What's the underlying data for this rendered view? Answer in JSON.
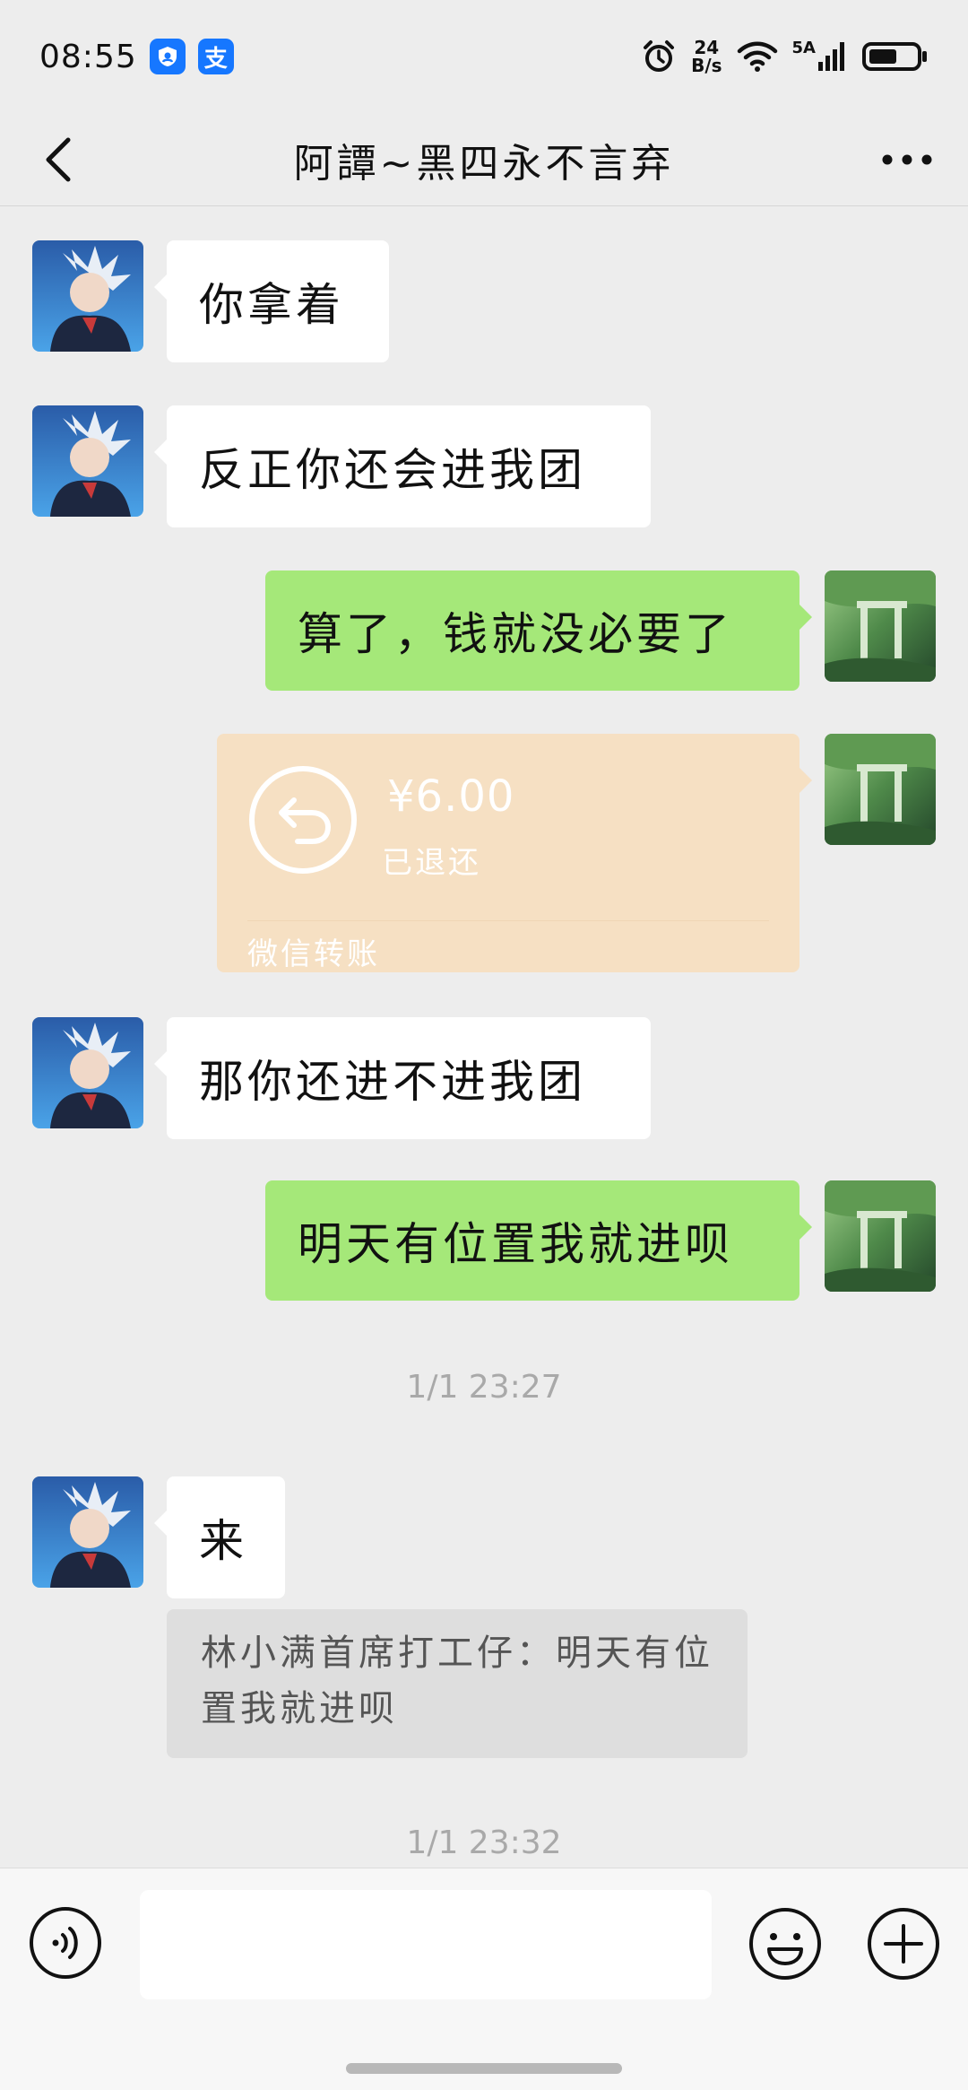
{
  "status_bar": {
    "time": "08:55",
    "badge_alipay": "支",
    "net_speed_value": "24",
    "net_speed_unit": "B/s",
    "network": "5A"
  },
  "header": {
    "title": "阿譚~黑四永不言弃",
    "back_icon": "chevron-left-icon",
    "more_icon": "more-dots-icon"
  },
  "messages": [
    {
      "side": "in",
      "text": "你拿着"
    },
    {
      "side": "in",
      "text": "反正你还会进我团"
    },
    {
      "side": "out",
      "text": "算了，钱就没必要了"
    },
    {
      "side": "out",
      "type": "transfer",
      "amount": "¥6.00",
      "status": "已退还",
      "label": "微信转账"
    },
    {
      "side": "in",
      "text": "那你还进不进我团"
    },
    {
      "side": "out",
      "text": "明天有位置我就进呗"
    },
    {
      "type": "time",
      "text": "1/1 23:27"
    },
    {
      "side": "in",
      "text": "来"
    },
    {
      "type": "quote",
      "text": "林小满首席打工仔：明天有位置我就进呗"
    },
    {
      "type": "time",
      "text": "1/1 23:32"
    }
  ],
  "input_bar": {
    "voice_icon": "voice-icon",
    "input_value": "",
    "emoji_icon": "emoji-icon",
    "plus_icon": "plus-icon"
  },
  "colors": {
    "background": "#ededed",
    "incoming_bubble": "#ffffff",
    "outgoing_bubble": "#a5e879",
    "transfer_bubble": "#f6e0c3",
    "timestamp_text": "#a9a9a9",
    "alipay_blue": "#1677ff"
  }
}
